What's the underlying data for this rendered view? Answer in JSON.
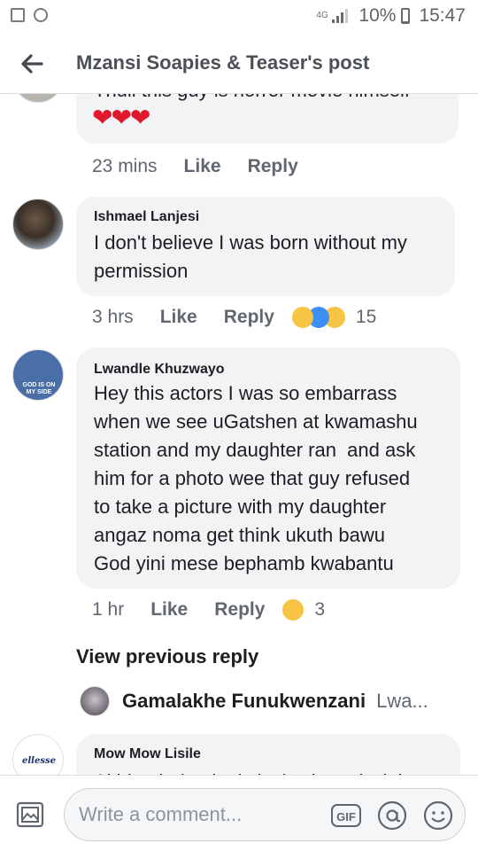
{
  "status_bar": {
    "network": "4G",
    "battery_text": "10%",
    "battery_level": 0.1,
    "time": "15:47"
  },
  "header": {
    "title": "Mzansi Soapies & Teaser's post"
  },
  "comments": [
    {
      "partial_text": "Thuli this guy is horror movie himself",
      "hearts": "❤❤❤",
      "time": "23 mins",
      "like": "Like",
      "reply": "Reply"
    },
    {
      "author": "Ishmael Lanjesi",
      "lines": [
        "I don't believe I was born without my",
        "permission"
      ],
      "time": "3 hrs",
      "like": "Like",
      "reply": "Reply",
      "reactions": [
        "haha",
        "wow",
        "sad"
      ],
      "reaction_count": "15"
    },
    {
      "author": "Lwandle Khuzwayo",
      "avatar_text": "GOD IS ON MY SIDE",
      "lines": [
        "Hey this actors I was so embarrass",
        "when we see uGatshen at kwamashu",
        "station and my daughter ran  and ask",
        "him for a photo wee that guy refused",
        "to take a picture with my daughter",
        "angaz noma get think ukuth bawu",
        "God yini mese bephamb kwabantu"
      ],
      "time": "1 hr",
      "like": "Like",
      "reply": "Reply",
      "reactions": [
        "sad"
      ],
      "reaction_count": "3"
    }
  ],
  "view_previous_reply": "View previous reply",
  "reply_preview": {
    "name": "Gamalakhe Funukwenzani",
    "snippet": "Lwa..."
  },
  "last_comment": {
    "author": "Mow Mow Lisile",
    "avatar_text": "ellesse",
    "partial_text": "Akhkuphela ukuti sisejwabeza kwini"
  },
  "composer": {
    "placeholder": "Write a comment...",
    "gif_label": "GIF"
  },
  "colors": {
    "meta_grey": "#606770",
    "bubble_bg": "#f2f3f5",
    "heart_red": "#e0182d",
    "haha_yellow": "#f7c444",
    "wow_blue": "#3b8ff5"
  },
  "icons": {
    "back": "arrow-left-icon",
    "photo": "photo-icon",
    "gif": "gif-icon",
    "sticker": "at-sticker-icon",
    "emoji": "smiley-icon"
  }
}
